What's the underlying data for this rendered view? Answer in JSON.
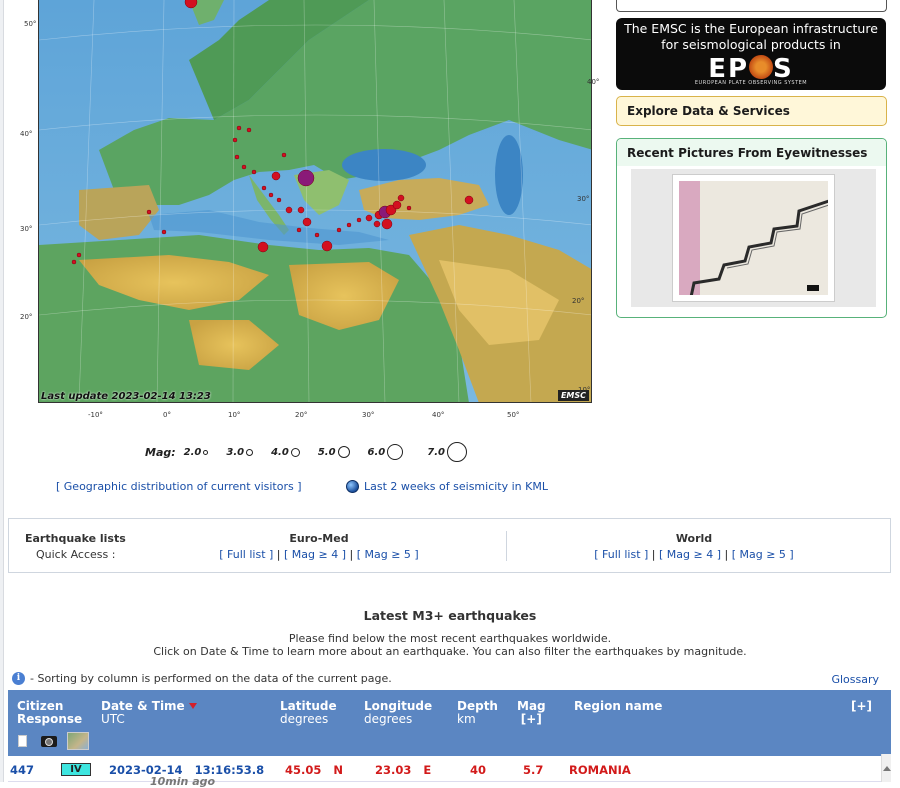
{
  "map": {
    "last_update": "Last update 2023-02-14 13:23",
    "logo": "EMSC",
    "lon_ticks": [
      "-10°",
      "0°",
      "10°",
      "20°",
      "30°",
      "40°",
      "50°"
    ],
    "lat_left": [
      "50°",
      "40°",
      "30°",
      "20°"
    ],
    "lat_right": [
      "40°",
      "30°",
      "20°",
      "10°"
    ]
  },
  "mag_legend": {
    "label": "Mag:",
    "items": [
      "2.0",
      "3.0",
      "4.0",
      "5.0",
      "6.0",
      "7.0"
    ]
  },
  "links": {
    "visitors": "[ Geographic distribution of current visitors ]",
    "kml": "Last 2 weeks of seismicity in KML"
  },
  "sidebar": {
    "epos_text": "The EMSC is the European infrastructure for seismological products in",
    "epos_logo": "EP S",
    "epos_sub": "EUROPEAN PLATE OBSERVING SYSTEM",
    "explore": "Explore Data & Services",
    "pictures_title": "Recent Pictures From Eyewitnesses"
  },
  "quick_access": {
    "title": "Earthquake lists",
    "subtitle": "Quick Access :",
    "euromed": {
      "heading": "Euro-Med",
      "links": [
        "[ Full list ]",
        "[ Mag ≥ 4 ]",
        "[ Mag ≥ 5 ]"
      ]
    },
    "world": {
      "heading": "World",
      "links": [
        "[ Full list ]",
        "[ Mag ≥ 4 ]",
        "[ Mag ≥ 5 ]"
      ]
    }
  },
  "latest": {
    "title": "Latest M3+ earthquakes",
    "desc1": "Please find below the most recent earthquakes worldwide.",
    "desc2": "Click on Date & Time to learn more about an earthquake. You can also filter the earthquakes by magnitude.",
    "sort_note": "- Sorting by column is performed on the data of the current page.",
    "glossary": "Glossary"
  },
  "table": {
    "headers": {
      "citizen": "Citizen",
      "response": "Response",
      "datetime": "Date & Time",
      "utc": "UTC",
      "lat": "Latitude",
      "lat_unit": "degrees",
      "lon": "Longitude",
      "lon_unit": "degrees",
      "depth": "Depth",
      "depth_unit": "km",
      "mag": "Mag",
      "mag_toggle": "[+]",
      "region": "Region name",
      "expand": "[+]"
    },
    "rows": [
      {
        "responses": "447",
        "intensity": "IV",
        "date": "2023-02-14",
        "time": "13:16:53.8",
        "ago": "10min ago",
        "lat": "45.05",
        "lat_dir": "N",
        "lon": "23.03",
        "lon_dir": "E",
        "depth": "40",
        "mag": "5.7",
        "region": "ROMANIA"
      }
    ]
  },
  "colors": {
    "header_bg": "#5b86c2",
    "link": "#1a4fa8",
    "alert": "#d21a1a",
    "intensity_iv": "#3ee6e0"
  }
}
